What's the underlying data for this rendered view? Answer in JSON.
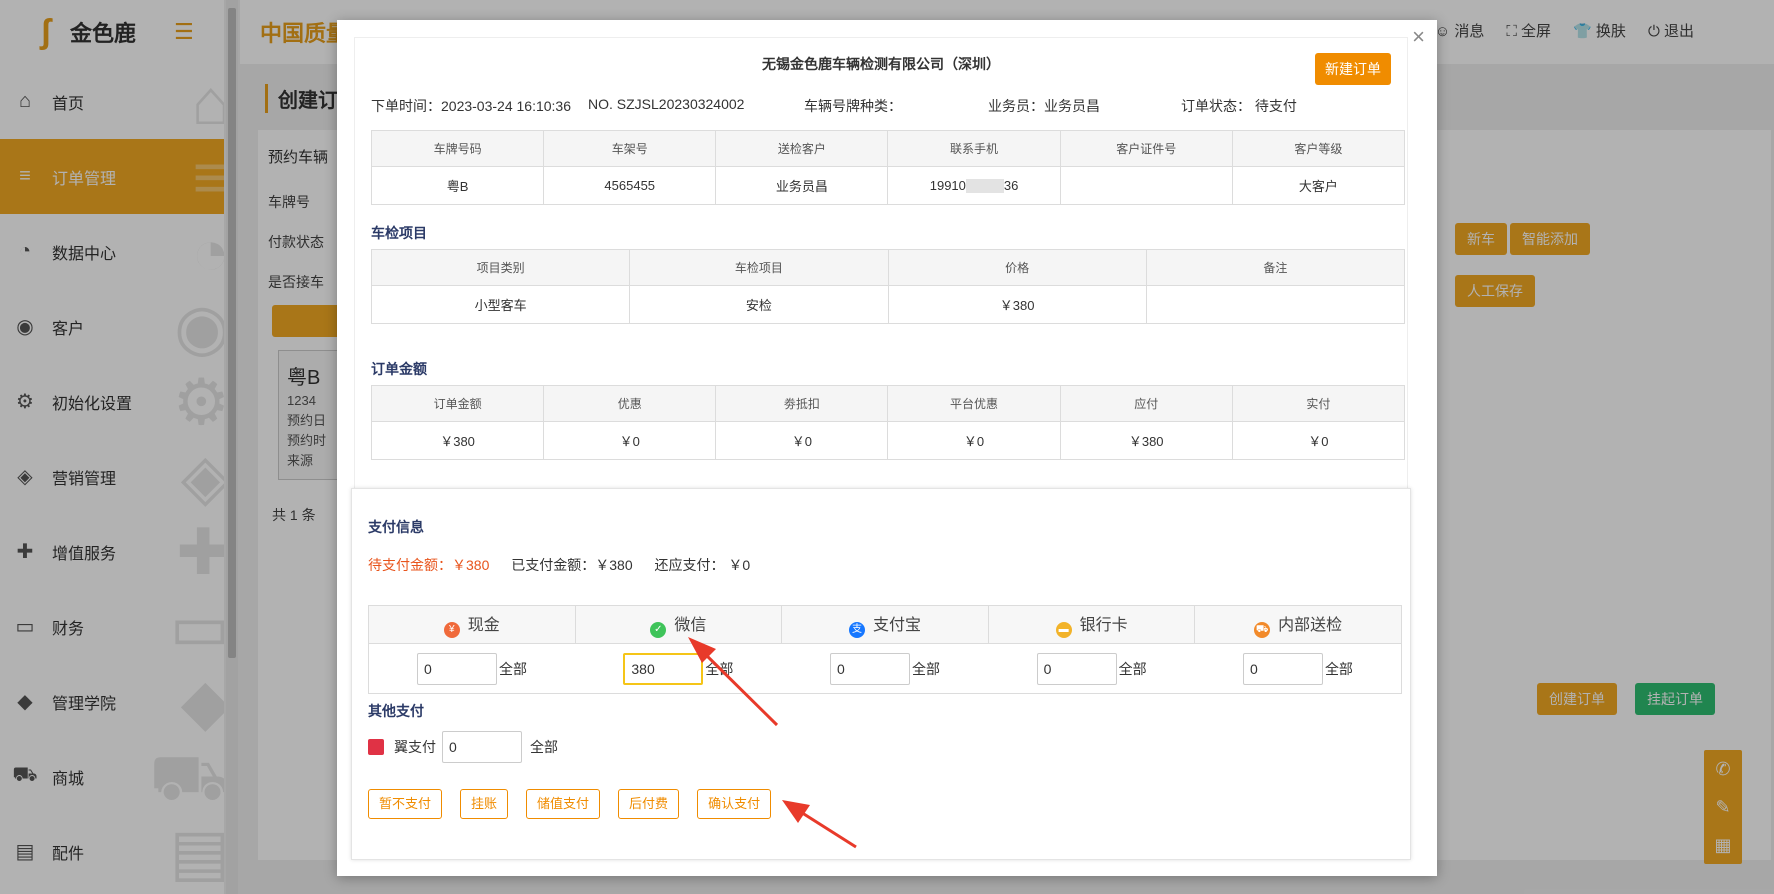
{
  "app": {
    "logo_text": "金色鹿",
    "brand_title": "中国质量",
    "top_actions": [
      "消息",
      "全屏",
      "换肤",
      "退出"
    ],
    "page_title": "创建订",
    "sidebar": [
      {
        "label": "首页",
        "icon": "home-icon"
      },
      {
        "label": "订单管理",
        "icon": "list-icon",
        "active": true
      },
      {
        "label": "数据中心",
        "icon": "chart-icon"
      },
      {
        "label": "客户",
        "icon": "user-icon"
      },
      {
        "label": "初始化设置",
        "icon": "gear-icon"
      },
      {
        "label": "营销管理",
        "icon": "tag-icon"
      },
      {
        "label": "增值服务",
        "icon": "add-user-icon"
      },
      {
        "label": "财务",
        "icon": "card-icon"
      },
      {
        "label": "管理学院",
        "icon": "graduation-icon"
      },
      {
        "label": "商城",
        "icon": "cart-icon"
      },
      {
        "label": "配件",
        "icon": "clipboard-icon"
      }
    ],
    "left_panel": {
      "heading": "预约车辆",
      "rows": [
        "车牌号",
        "付款状态",
        "是否接车"
      ],
      "card_plate": "粤B",
      "card_lines": [
        "1234",
        "预约日",
        "预约时",
        "来源"
      ],
      "total": "共 1 条"
    },
    "right_panel": {
      "btn_new_car": "新车",
      "btn_smart_add": "智能添加",
      "btn_manual_save": "人工保存",
      "btn_create_order": "创建订单",
      "btn_hang_order": "挂起订单"
    }
  },
  "modal": {
    "close": "×",
    "company": "无锡金色鹿车辆检测有限公司（深圳）",
    "new_order_button": "新建订单",
    "order_time": "下单时间：2023-03-24 16:10:36",
    "order_no": "NO. SZJSL20230324002",
    "plate_type": "车辆号牌种类：",
    "salesperson": "业务员：业务员昌",
    "status": "订单状态： 待支付",
    "vehicle_table": {
      "headers": [
        "车牌号码",
        "车架号",
        "送检客户",
        "联系手机",
        "客户证件号",
        "客户等级"
      ],
      "row": [
        "粤B",
        "4565455",
        "业务员昌",
        "19910",
        "",
        "大客户"
      ],
      "phone_suffix": "36"
    },
    "inspection_section": "车检项目",
    "inspection_table": {
      "headers": [
        "项目类别",
        "车检项目",
        "价格",
        "备注"
      ],
      "row": [
        "小型客车",
        "安检",
        "￥380",
        ""
      ]
    },
    "amount_section": "订单金额",
    "amount_table": {
      "headers": [
        "订单金额",
        "优惠",
        "劵抵扣",
        "平台优惠",
        "应付",
        "实付"
      ],
      "row": [
        "￥380",
        "￥0",
        "￥0",
        "￥0",
        "￥380",
        "￥0"
      ]
    },
    "payment": {
      "section": "支付信息",
      "due": "待支付金额：￥380",
      "paid": "已支付金额：￥380",
      "remaining": "还应支付： ￥0",
      "methods": [
        {
          "label": "现金",
          "value": "0",
          "icon": "cash-icon",
          "color": "#f06a3b"
        },
        {
          "label": "微信",
          "value": "380",
          "icon": "wechat-icon",
          "color": "#3fc45a"
        },
        {
          "label": "支付宝",
          "value": "0",
          "icon": "alipay-icon",
          "color": "#1677ff"
        },
        {
          "label": "银行卡",
          "value": "0",
          "icon": "bank-card-icon",
          "color": "#f2b32a"
        },
        {
          "label": "内部送检",
          "value": "0",
          "icon": "car-icon",
          "color": "#f28a2a"
        }
      ],
      "all_label": "全部",
      "other_section": "其他支付",
      "yi_label": "翼支付",
      "yi_value": "0",
      "buttons": [
        "暂不支付",
        "挂账",
        "储值支付",
        "后付费",
        "确认支付"
      ]
    }
  }
}
